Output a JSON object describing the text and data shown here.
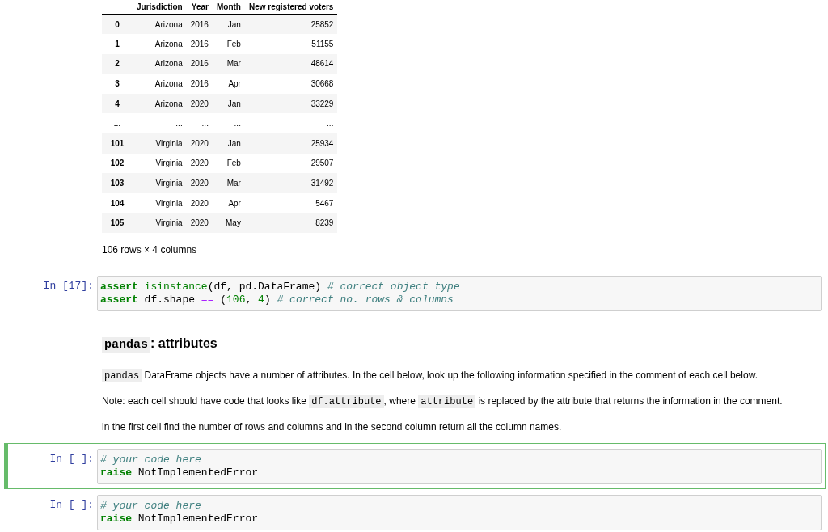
{
  "cells": [
    {
      "kind": "output",
      "table": {
        "columns": [
          "Jurisdiction",
          "Year",
          "Month",
          "New registered voters"
        ],
        "rows": [
          {
            "index": "0",
            "cells": [
              "Arizona",
              "2016",
              "Jan",
              "25852"
            ]
          },
          {
            "index": "1",
            "cells": [
              "Arizona",
              "2016",
              "Feb",
              "51155"
            ]
          },
          {
            "index": "2",
            "cells": [
              "Arizona",
              "2016",
              "Mar",
              "48614"
            ]
          },
          {
            "index": "3",
            "cells": [
              "Arizona",
              "2016",
              "Apr",
              "30668"
            ]
          },
          {
            "index": "4",
            "cells": [
              "Arizona",
              "2020",
              "Jan",
              "33229"
            ]
          },
          {
            "index": "...",
            "cells": [
              "...",
              "...",
              "...",
              "..."
            ]
          },
          {
            "index": "101",
            "cells": [
              "Virginia",
              "2020",
              "Jan",
              "25934"
            ]
          },
          {
            "index": "102",
            "cells": [
              "Virginia",
              "2020",
              "Feb",
              "29507"
            ]
          },
          {
            "index": "103",
            "cells": [
              "Virginia",
              "2020",
              "Mar",
              "31492"
            ]
          },
          {
            "index": "104",
            "cells": [
              "Virginia",
              "2020",
              "Apr",
              "5467"
            ]
          },
          {
            "index": "105",
            "cells": [
              "Virginia",
              "2020",
              "May",
              "8239"
            ]
          }
        ],
        "caption": "106 rows × 4 columns"
      }
    },
    {
      "kind": "code",
      "prompt": "In [17]:",
      "selected": false,
      "lines": [
        [
          {
            "kind": "keyword",
            "text": "assert "
          },
          {
            "kind": "builtin",
            "text": "isinstance"
          },
          {
            "kind": "plain",
            "text": "(df, pd.DataFrame) "
          },
          {
            "kind": "comment",
            "text": "# correct object type"
          }
        ],
        [
          {
            "kind": "keyword",
            "text": "assert"
          },
          {
            "kind": "plain",
            "text": " df.shape "
          },
          {
            "kind": "operator",
            "text": "=="
          },
          {
            "kind": "plain",
            "text": " ("
          },
          {
            "kind": "number",
            "text": "106"
          },
          {
            "kind": "plain",
            "text": ", "
          },
          {
            "kind": "number",
            "text": "4"
          },
          {
            "kind": "plain",
            "text": ") "
          },
          {
            "kind": "comment",
            "text": "# correct no. rows & columns"
          }
        ]
      ]
    },
    {
      "kind": "markdown",
      "blocks": [
        {
          "kind": "heading",
          "segments": [
            {
              "kind": "code",
              "text": "pandas"
            },
            {
              "kind": "text",
              "text": ": attributes"
            }
          ]
        },
        {
          "kind": "paragraph",
          "segments": [
            {
              "kind": "code",
              "text": "pandas"
            },
            {
              "kind": "text",
              "text": " DataFrame objects have a number of attributes. In the cell below, look up the following information specified in the comment of each cell below."
            }
          ]
        },
        {
          "kind": "paragraph",
          "segments": [
            {
              "kind": "text",
              "text": "Note: each cell should have code that looks like "
            },
            {
              "kind": "code",
              "text": "df.attribute"
            },
            {
              "kind": "text",
              "text": ", where "
            },
            {
              "kind": "code",
              "text": "attribute"
            },
            {
              "kind": "text",
              "text": " is replaced by the attribute that returns the information in the comment."
            }
          ]
        },
        {
          "kind": "paragraph",
          "segments": [
            {
              "kind": "text",
              "text": "in the first cell find the number of rows and columns and in the second column return all the column names."
            }
          ]
        }
      ]
    },
    {
      "kind": "code",
      "prompt": "In [ ]:",
      "selected": true,
      "lines": [
        [
          {
            "kind": "comment",
            "text": "# your code here"
          }
        ],
        [
          {
            "kind": "keyword",
            "text": "raise"
          },
          {
            "kind": "plain",
            "text": " NotImplementedError"
          }
        ]
      ]
    },
    {
      "kind": "code",
      "prompt": "In [ ]:",
      "selected": false,
      "lines": [
        [
          {
            "kind": "comment",
            "text": "# your code here"
          }
        ],
        [
          {
            "kind": "keyword",
            "text": "raise"
          },
          {
            "kind": "plain",
            "text": " NotImplementedError"
          }
        ]
      ]
    }
  ]
}
